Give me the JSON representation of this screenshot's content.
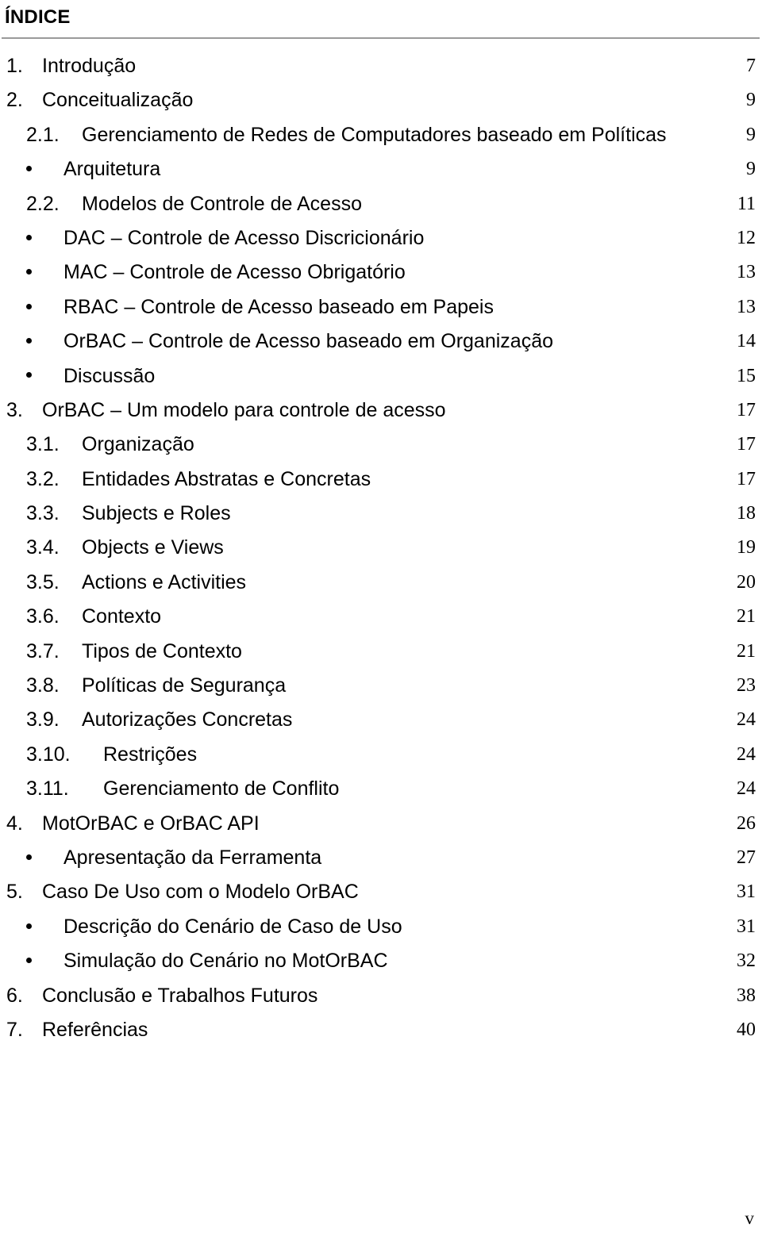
{
  "document": {
    "title": "ÍNDICE",
    "footer_page_marker": "v"
  },
  "toc": {
    "entries": [
      {
        "level": "lvl1",
        "marker": "1.",
        "label": "Introdução",
        "page": "7"
      },
      {
        "level": "lvl1",
        "marker": "2.",
        "label": "Conceitualização",
        "page": "9"
      },
      {
        "level": "lvl2",
        "marker": "2.1.",
        "label": "Gerenciamento de Redes de Computadores baseado em Políticas",
        "page": "9"
      },
      {
        "level": "bul",
        "marker": "•",
        "label": "Arquitetura",
        "page": "9"
      },
      {
        "level": "lvl2",
        "marker": "2.2.",
        "label": "Modelos de Controle de Acesso",
        "page": "11"
      },
      {
        "level": "bul",
        "marker": "•",
        "label": "DAC – Controle de Acesso Discricionário",
        "page": "12"
      },
      {
        "level": "bul",
        "marker": "•",
        "label": "MAC – Controle de Acesso Obrigatório",
        "page": "13"
      },
      {
        "level": "bul",
        "marker": "•",
        "label": "RBAC – Controle de Acesso baseado em Papeis",
        "page": "13"
      },
      {
        "level": "bul",
        "marker": "•",
        "label": "OrBAC – Controle de Acesso baseado em Organização",
        "page": "14"
      },
      {
        "level": "bul",
        "marker": "•",
        "label": "Discussão",
        "page": "15"
      },
      {
        "level": "lvl1",
        "marker": "3.",
        "label": "OrBAC – Um modelo para controle de acesso",
        "page": "17"
      },
      {
        "level": "lvl2",
        "marker": "3.1.",
        "label": "Organização",
        "page": "17"
      },
      {
        "level": "lvl2",
        "marker": "3.2.",
        "label": "Entidades Abstratas e Concretas",
        "page": "17"
      },
      {
        "level": "lvl2",
        "marker": "3.3.",
        "label": "Subjects e Roles",
        "page": "18"
      },
      {
        "level": "lvl2",
        "marker": "3.4.",
        "label": "Objects e Views",
        "page": "19"
      },
      {
        "level": "lvl2",
        "marker": "3.5.",
        "label": "Actions e Activities",
        "page": "20"
      },
      {
        "level": "lvl2",
        "marker": "3.6.",
        "label": "Contexto",
        "page": "21"
      },
      {
        "level": "lvl2",
        "marker": "3.7.",
        "label": "Tipos de Contexto",
        "page": "21"
      },
      {
        "level": "lvl2",
        "marker": "3.8.",
        "label": "Políticas de Segurança",
        "page": "23"
      },
      {
        "level": "lvl2",
        "marker": "3.9.",
        "label": "Autorizações Concretas",
        "page": "24"
      },
      {
        "level": "lvl2w",
        "marker": "3.10.",
        "label": "Restrições",
        "page": "24"
      },
      {
        "level": "lvl2w",
        "marker": "3.11.",
        "label": "Gerenciamento de Conflito",
        "page": "24"
      },
      {
        "level": "lvl1",
        "marker": "4.",
        "label": "MotOrBAC e OrBAC API",
        "page": "26"
      },
      {
        "level": "bul",
        "marker": "•",
        "label": "Apresentação da Ferramenta",
        "page": "27"
      },
      {
        "level": "lvl1",
        "marker": "5.",
        "label": "Caso De Uso com o Modelo OrBAC",
        "page": "31"
      },
      {
        "level": "bul",
        "marker": "•",
        "label": "Descrição do Cenário de Caso de Uso",
        "page": "31"
      },
      {
        "level": "bul",
        "marker": "•",
        "label": "Simulação do Cenário no MotOrBAC",
        "page": "32"
      },
      {
        "level": "lvl1",
        "marker": "6.",
        "label": "Conclusão e Trabalhos Futuros",
        "page": "38"
      },
      {
        "level": "lvl1",
        "marker": "7.",
        "label": "Referências",
        "page": "40"
      }
    ]
  }
}
